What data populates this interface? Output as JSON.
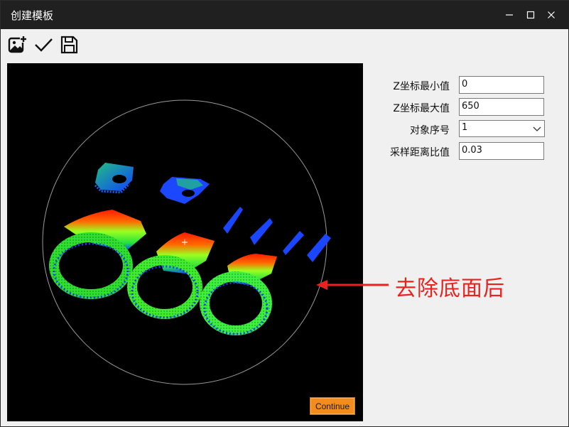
{
  "window": {
    "title": "创建模板"
  },
  "toolbar": {
    "buttons": [
      {
        "name": "add-image",
        "icon": "add-image-icon"
      },
      {
        "name": "confirm",
        "icon": "checkmark-icon"
      },
      {
        "name": "save",
        "icon": "save-icon"
      }
    ]
  },
  "viewer": {
    "continue_label": "Continue"
  },
  "params": {
    "z_min": {
      "label": "Z坐标最小值",
      "value": "0"
    },
    "z_max": {
      "label": "Z坐标最大值",
      "value": "650"
    },
    "object_index": {
      "label": "对象序号",
      "value": "1"
    },
    "sample_ratio": {
      "label": "采样距离比值",
      "value": "0.03"
    }
  },
  "annotation": {
    "text": "去除底面后",
    "color": "#e8231f"
  },
  "colors": {
    "titlebar": "#202020",
    "continue_button": "#f28c1e",
    "viewer_bg": "#000000"
  }
}
